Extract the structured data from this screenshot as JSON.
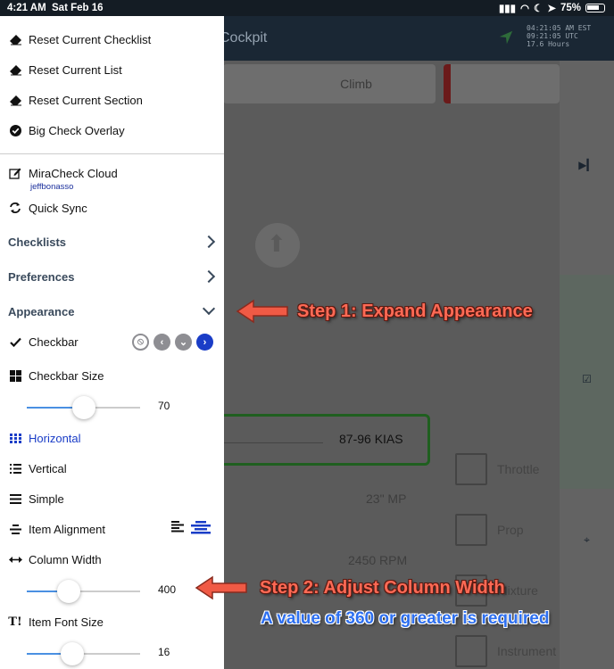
{
  "status_bar": {
    "time": "4:21 AM",
    "date": "Sat Feb 16",
    "battery": "75%"
  },
  "app": {
    "title": "Cockpit",
    "clock_lines": [
      "04:21:05 AM EST",
      "09:21:05 UTC",
      "17.6 Hours"
    ],
    "tab_climb": "Climb",
    "selected_value": "87-96 KIAS",
    "rows": [
      "23\" MP",
      "2450 RPM"
    ],
    "checkbox_labels": [
      "Throttle",
      "Prop",
      "Mixture",
      "Instrument"
    ]
  },
  "drawer": {
    "actions": [
      {
        "label": "Reset Current Checklist",
        "icon": "eraser-icon"
      },
      {
        "label": "Reset Current List",
        "icon": "eraser-icon"
      },
      {
        "label": "Reset Current Section",
        "icon": "eraser-icon"
      },
      {
        "label": "Big Check Overlay",
        "icon": "check-circle-icon"
      }
    ],
    "cloud": {
      "label": "MiraCheck Cloud",
      "username": "jeffbonasso"
    },
    "quick_sync": "Quick Sync",
    "sections": {
      "checklists": "Checklists",
      "preferences": "Preferences",
      "appearance": "Appearance"
    },
    "checkbar": "Checkbar",
    "checkbar_size": {
      "label": "Checkbar Size",
      "value": "70",
      "level": 0.5
    },
    "layouts": {
      "horizontal": "Horizontal",
      "vertical": "Vertical",
      "simple": "Simple"
    },
    "item_alignment": "Item Alignment",
    "column_width": {
      "label": "Column Width",
      "value": "400",
      "level": 0.37
    },
    "item_font_size": {
      "label": "Item Font Size",
      "value": "16",
      "level": 0.4
    }
  },
  "annotations": {
    "step1": "Step 1: Expand Appearance",
    "step2": "Step 2: Adjust Column Width",
    "note": "A value of 360 or greater is required"
  },
  "colors": {
    "accent": "#1a3dc7",
    "slider": "#4a90e2",
    "annotation": "#ff6a55",
    "note": "#2d6ff0"
  }
}
